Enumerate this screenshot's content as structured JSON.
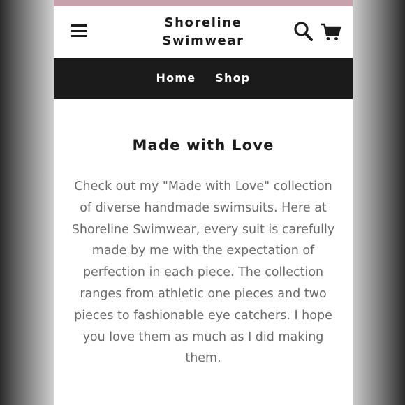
{
  "header": {
    "brand_line1": "Shoreline",
    "brand_line2": "Swimwear",
    "menu_icon": "hamburger-menu-icon",
    "search_icon": "search-icon",
    "cart_icon": "shopping-cart-icon"
  },
  "nav": {
    "items": [
      {
        "label": "Home"
      },
      {
        "label": "Shop"
      }
    ]
  },
  "main": {
    "title": "Made with Love",
    "body": "Check out my \"Made with Love\" collection of diverse handmade swimsuits. Here at Shoreline Swimwear, every suit is carefully made by me with the expectation of perfection in each piece. The collection ranges from athletic one pieces and two pieces to fashionable eye catchers. I hope you love them as much as I did making them."
  },
  "colors": {
    "top_accent": "#c7a1ab",
    "nav_background": "#1b1b1b",
    "body_text": "#6b6b6b",
    "heading_text": "#1c1c1c"
  }
}
